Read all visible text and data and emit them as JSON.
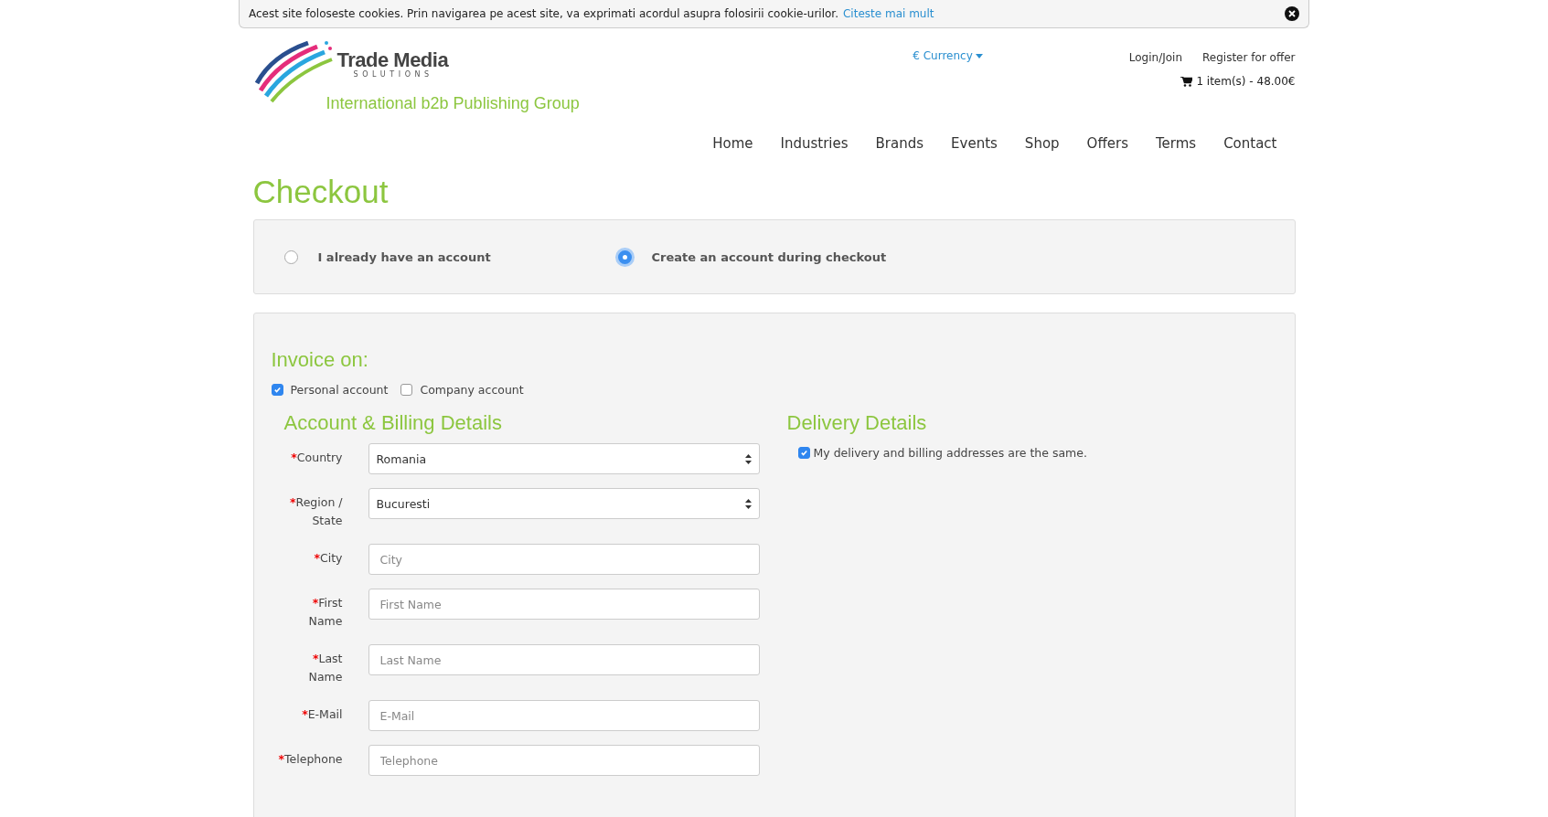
{
  "cookie_bar": {
    "message": "Acest site foloseste cookies. Prin navigarea pe acest site, va exprimati acordul asupra folosirii cookie-urilor.",
    "link": "Citeste mai mult"
  },
  "header": {
    "logo": {
      "name": "Trade Media",
      "sub": "SOLUTIONS",
      "tagline": "International b2b Publishing Group"
    },
    "currency": "€ Currency",
    "links": [
      "Login/Join",
      "Register for offer"
    ],
    "cart": "1 item(s) - 48.00€"
  },
  "nav": [
    {
      "label": "Home"
    },
    {
      "label": "Industries"
    },
    {
      "label": "Brands"
    },
    {
      "label": "Events"
    },
    {
      "label": "Shop"
    },
    {
      "label": "Offers"
    },
    {
      "label": "Terms"
    },
    {
      "label": "Contact"
    }
  ],
  "title": "Checkout",
  "account_options": [
    {
      "label": "I already have an account",
      "selected": false
    },
    {
      "label": "Create an account during checkout",
      "selected": true
    }
  ],
  "invoice": {
    "title": "Invoice on:",
    "options": [
      {
        "label": "Personal account",
        "checked": true
      },
      {
        "label": "Company account",
        "checked": false
      }
    ]
  },
  "billing": {
    "title": "Account & Billing Details",
    "required_marker": "*",
    "fields": [
      {
        "kind": "select",
        "label": "Country",
        "required": true,
        "value": "Romania"
      },
      {
        "kind": "select",
        "label": "Region / State",
        "required": true,
        "value": "Bucuresti"
      },
      {
        "kind": "text",
        "label": "City",
        "required": true,
        "placeholder": "City"
      },
      {
        "kind": "text",
        "label": "First Name",
        "required": true,
        "placeholder": "First Name"
      },
      {
        "kind": "text",
        "label": "Last Name",
        "required": true,
        "placeholder": "Last Name"
      },
      {
        "kind": "text",
        "label": "E-Mail",
        "required": true,
        "placeholder": "E-Mail"
      },
      {
        "kind": "text",
        "label": "Telephone",
        "required": true,
        "placeholder": "Telephone"
      }
    ]
  },
  "delivery": {
    "title": "Delivery Details",
    "same_address": {
      "label": "My delivery and billing addresses are the same.",
      "checked": true
    }
  }
}
